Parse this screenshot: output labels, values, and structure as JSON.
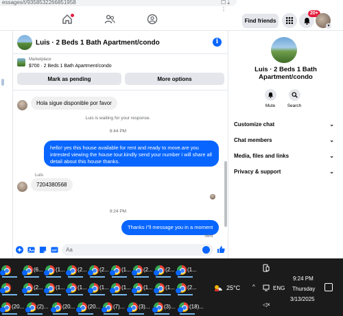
{
  "browser": {
    "url_fragment": "essages/t/9358532266851958",
    "url_icons": "☐ ⤓ ⋮"
  },
  "nav": {
    "find_friends_label": "Find friends",
    "notification_count": "20+"
  },
  "chat": {
    "title": "Luis · 2 Beds 1 Bath Apartment/condo",
    "marketplace": {
      "label": "Marketplace",
      "listing": "$700 · 2 Beds 1 Bath Apartment/condo",
      "mark_pending_label": "Mark as pending",
      "more_options_label": "More options"
    },
    "messages": {
      "incoming_1": "Hola sigue disponible por favor",
      "waiting_note": "Luis is waiting for your response.",
      "time_1": "8:44 PM",
      "outgoing_1": "hello! yes this house available for rent and ready to move.are you intrested viewing the house tour.kindly send your number i will share all detail about this house thanks.",
      "sender_name": "Luis",
      "incoming_2": "7204380568",
      "time_2": "9:24 PM",
      "outgoing_2": "Thanks i\"ll message you in a moment",
      "sent_label": "Sent"
    },
    "composer": {
      "placeholder": "Aa"
    }
  },
  "side_panel": {
    "name": "Luis · 2 Beds 1 Bath Apartment/condo",
    "mute_label": "Mute",
    "search_label": "Search",
    "sections": [
      "Customize chat",
      "Chat members",
      "Media, files and links",
      "Privacy & support"
    ]
  },
  "taskbar": {
    "row1": [
      "",
      "(6...",
      "(1...",
      "(2...",
      "(2...",
      "(1...",
      "(2...",
      "(2...",
      "(1...",
      "(2..."
    ],
    "row2": [
      "",
      "(2...",
      "(1...",
      "(1...",
      "(1...",
      "(1...",
      "(1...",
      "(1...",
      "(2..."
    ],
    "row3": [
      "(20...",
      "(2)...",
      "(20...",
      "(20...",
      "(7)...",
      "(3)...",
      "(3)...",
      "(18)..."
    ],
    "temperature": "25°C",
    "language": "ENG",
    "time": "9:24 PM",
    "day": "Thursday",
    "date": "3/13/2025"
  },
  "colors": {
    "accent": "#0866ff",
    "badge": "#e41e3f",
    "taskbar_bg": "#1b1b1b"
  }
}
